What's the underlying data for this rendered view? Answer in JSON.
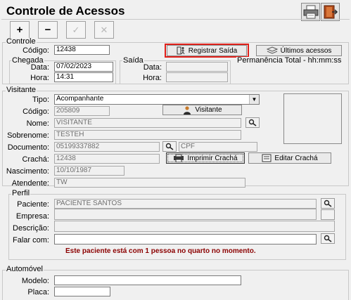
{
  "window": {
    "title": "Controle de Acessos"
  },
  "header": {
    "print_icon": "printer-icon",
    "exit_icon": "exit-door-icon"
  },
  "toolbar": {
    "add": "+",
    "remove": "−",
    "confirm": "✓",
    "cancel": "✕"
  },
  "controle": {
    "group_label": "Controle",
    "codigo_label": "Código:",
    "codigo_value": "12438",
    "registrar_label": "Registrar Saída",
    "ultimos_label": "Últimos acessos",
    "highlight_color": "#e0201a"
  },
  "chegada": {
    "group_label": "Chegada",
    "data_label": "Data:",
    "data_value": "07/02/2023",
    "hora_label": "Hora:",
    "hora_value": "14:31"
  },
  "saida": {
    "group_label": "Saída",
    "data_label": "Data:",
    "data_value": "",
    "hora_label": "Hora:",
    "hora_value": ""
  },
  "permanencia": {
    "label": "Permanência Total - hh:mm:ss"
  },
  "visitante": {
    "group_label": "Visitante",
    "tipo_label": "Tipo:",
    "tipo_value": "Acompanhante",
    "codigo_label": "Código:",
    "codigo_value": "205809",
    "visitante_button": "Visitante",
    "nome_label": "Nome:",
    "nome_value": "VISITANTE",
    "sobrenome_label": "Sobrenome:",
    "sobrenome_value": "TESTEH",
    "documento_label": "Documento:",
    "documento_value": "05199337882",
    "doc_tipo_value": "CPF",
    "cracha_label": "Crachá:",
    "cracha_value": "12438",
    "imprimir_cracha": "Imprimir Crachá",
    "editar_cracha": "Editar Crachá",
    "nascimento_label": "Nascimento:",
    "nascimento_value": "10/10/1987",
    "atendente_label": "Atendente:",
    "atendente_value": "TW"
  },
  "perfil": {
    "group_label": "Perfil",
    "paciente_label": "Paciente:",
    "paciente_value": "PACIENTE SANTOS",
    "empresa_label": "Empresa:",
    "empresa_value": "",
    "descricao_label": "Descrição:",
    "descricao_value": "",
    "falar_label": "Falar com:",
    "falar_value": "",
    "message": "Este paciente está com 1 pessoa no quarto no momento."
  },
  "automovel": {
    "group_label": "Automóvel",
    "modelo_label": "Modelo:",
    "modelo_value": "",
    "placa_label": "Placa:",
    "placa_value": ""
  }
}
